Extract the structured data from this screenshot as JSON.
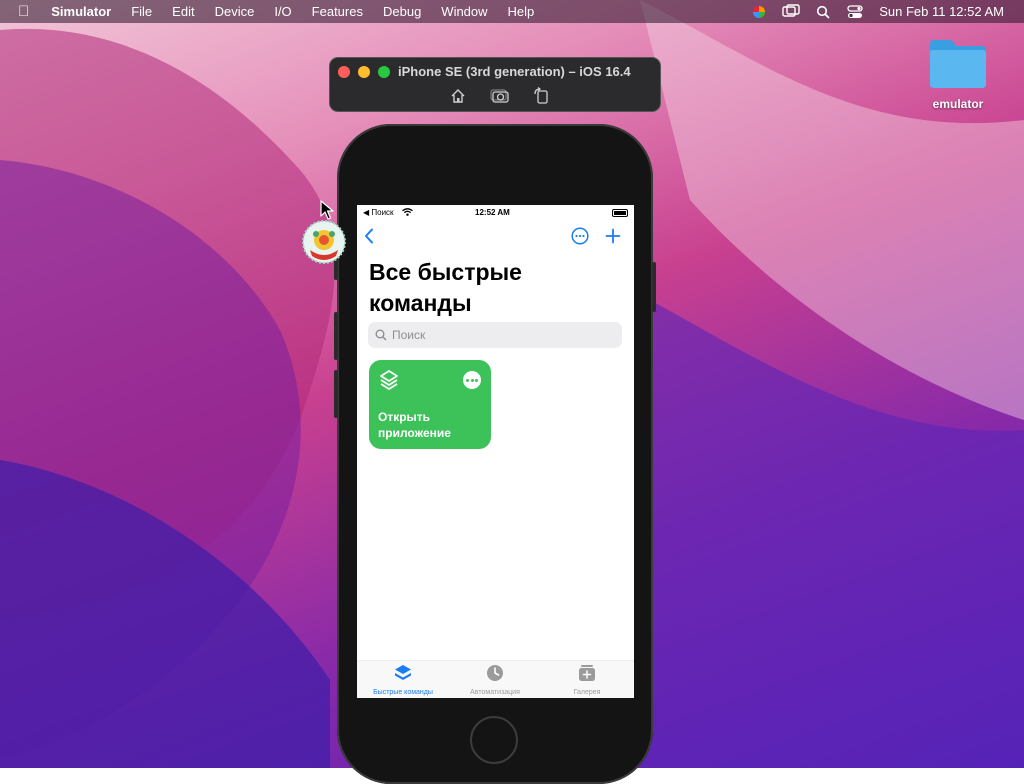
{
  "menubar": {
    "app": "Simulator",
    "menus": [
      "File",
      "Edit",
      "Device",
      "I/O",
      "Features",
      "Debug",
      "Window",
      "Help"
    ],
    "clock": "Sun Feb 11  12:52 AM"
  },
  "desktop": {
    "folder_label": "emulator"
  },
  "simulator": {
    "window_title": "iPhone SE (3rd generation) – iOS 16.4"
  },
  "ios": {
    "status": {
      "left": "◀ Поиск",
      "time": "12:52 AM"
    },
    "page_title": "Все быстрые команды",
    "search_placeholder": "Поиск",
    "shortcut_card": {
      "title": "Открыть приложение",
      "color": "#3dc25a"
    },
    "tabs": [
      {
        "label": "Быстрые команды",
        "active": true,
        "color": "#1a7cf2"
      },
      {
        "label": "Автоматизация",
        "active": false,
        "color": "#9b9b9b"
      },
      {
        "label": "Галерея",
        "active": false,
        "color": "#9b9b9b"
      }
    ],
    "accent": "#1a7cf2"
  }
}
